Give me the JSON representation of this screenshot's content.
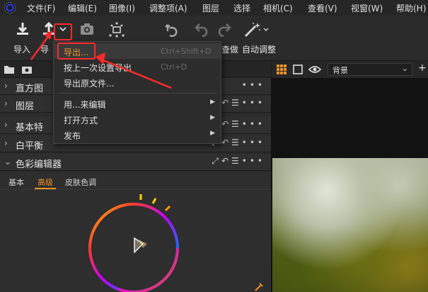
{
  "menubar": {
    "items": [
      "文件(F)",
      "编辑(E)",
      "图像(I)",
      "调整项(A)",
      "图层",
      "选择",
      "相机(C)",
      "查看(V)",
      "视窗(W)",
      "帮助(H)"
    ]
  },
  "toolbar": {
    "import_label": "导入",
    "export_label": "导",
    "partial_label": "查做",
    "auto_adjust_label": "自动调整"
  },
  "panels": {
    "histogram": "直方图",
    "layers": "图层",
    "basic": "基本特",
    "white_balance": "白平衡",
    "color_editor": "色彩编辑器"
  },
  "color_editor": {
    "tabs": [
      "基本",
      "高级",
      "皮肤色调"
    ],
    "active_tab": "高级"
  },
  "viewer": {
    "background_label": "背景"
  },
  "export_menu": {
    "items": [
      {
        "label": "导出...",
        "shortcut": "Ctrl+Shift+D"
      },
      {
        "label": "按上一次设置导出",
        "shortcut": "Ctrl+D"
      },
      {
        "label": "导出原文件..."
      },
      {
        "label": "用...来编辑"
      },
      {
        "label": "打开方式"
      },
      {
        "label": "发布"
      }
    ]
  },
  "colors": {
    "accent": "#f0932b",
    "annotation": "#ff2a2a"
  }
}
